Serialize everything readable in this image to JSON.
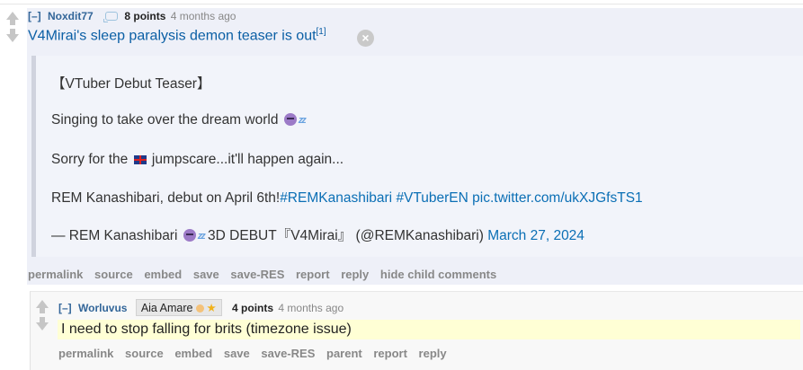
{
  "main_comment": {
    "expand": "[–]",
    "author": "Noxdit77",
    "score": "8 points",
    "time": "4 months ago",
    "title": "V4Mirai's sleep paralysis demon teaser is out",
    "footnote": "[1]",
    "close_symbol": "×",
    "quote": {
      "line1": "【VTuber Debut Teaser】",
      "line2": "Singing to take over the dream world",
      "line3_before": "Sorry for the",
      "line3_after": "jumpscare...it'll happen again...",
      "line4_text": "REM Kanashibari, debut on April 6th!",
      "line4_tag1": "#REMKanashibari",
      "line4_tag2": "#VTuberEN",
      "line4_link": "pic.twitter.com/ukXJGfsTS1",
      "line5_prefix": "— REM Kanashibari",
      "line5_text": "3D DEBUT『V4Mirai』 (@REMKanashibari)",
      "line5_date": "March 27, 2024"
    },
    "buttons": [
      "permalink",
      "source",
      "embed",
      "save",
      "save-RES",
      "report",
      "reply",
      "hide child comments"
    ]
  },
  "child_comment": {
    "expand": "[–]",
    "author": "Worluvus",
    "flair": "Aia Amare",
    "score": "4 points",
    "time": "4 months ago",
    "body": "I need to stop falling for brits (timezone issue)",
    "buttons": [
      "permalink",
      "source",
      "embed",
      "save",
      "save-RES",
      "parent",
      "report",
      "reply"
    ]
  },
  "icons": {
    "vote_up": "upvote-arrow-icon",
    "vote_down": "downvote-arrow-icon",
    "comment_bubble": "comment-bubble-icon",
    "close": "close-icon",
    "emoji_face": "purple-face-emoji",
    "emoji_zz": "sleep-zz-emoji",
    "flag": "uk-flag-emoji"
  },
  "colors": {
    "link": "#0b5fa5",
    "author": "#336699",
    "main_bg": "#eef0f8",
    "child_highlight": "#ffffd5"
  }
}
